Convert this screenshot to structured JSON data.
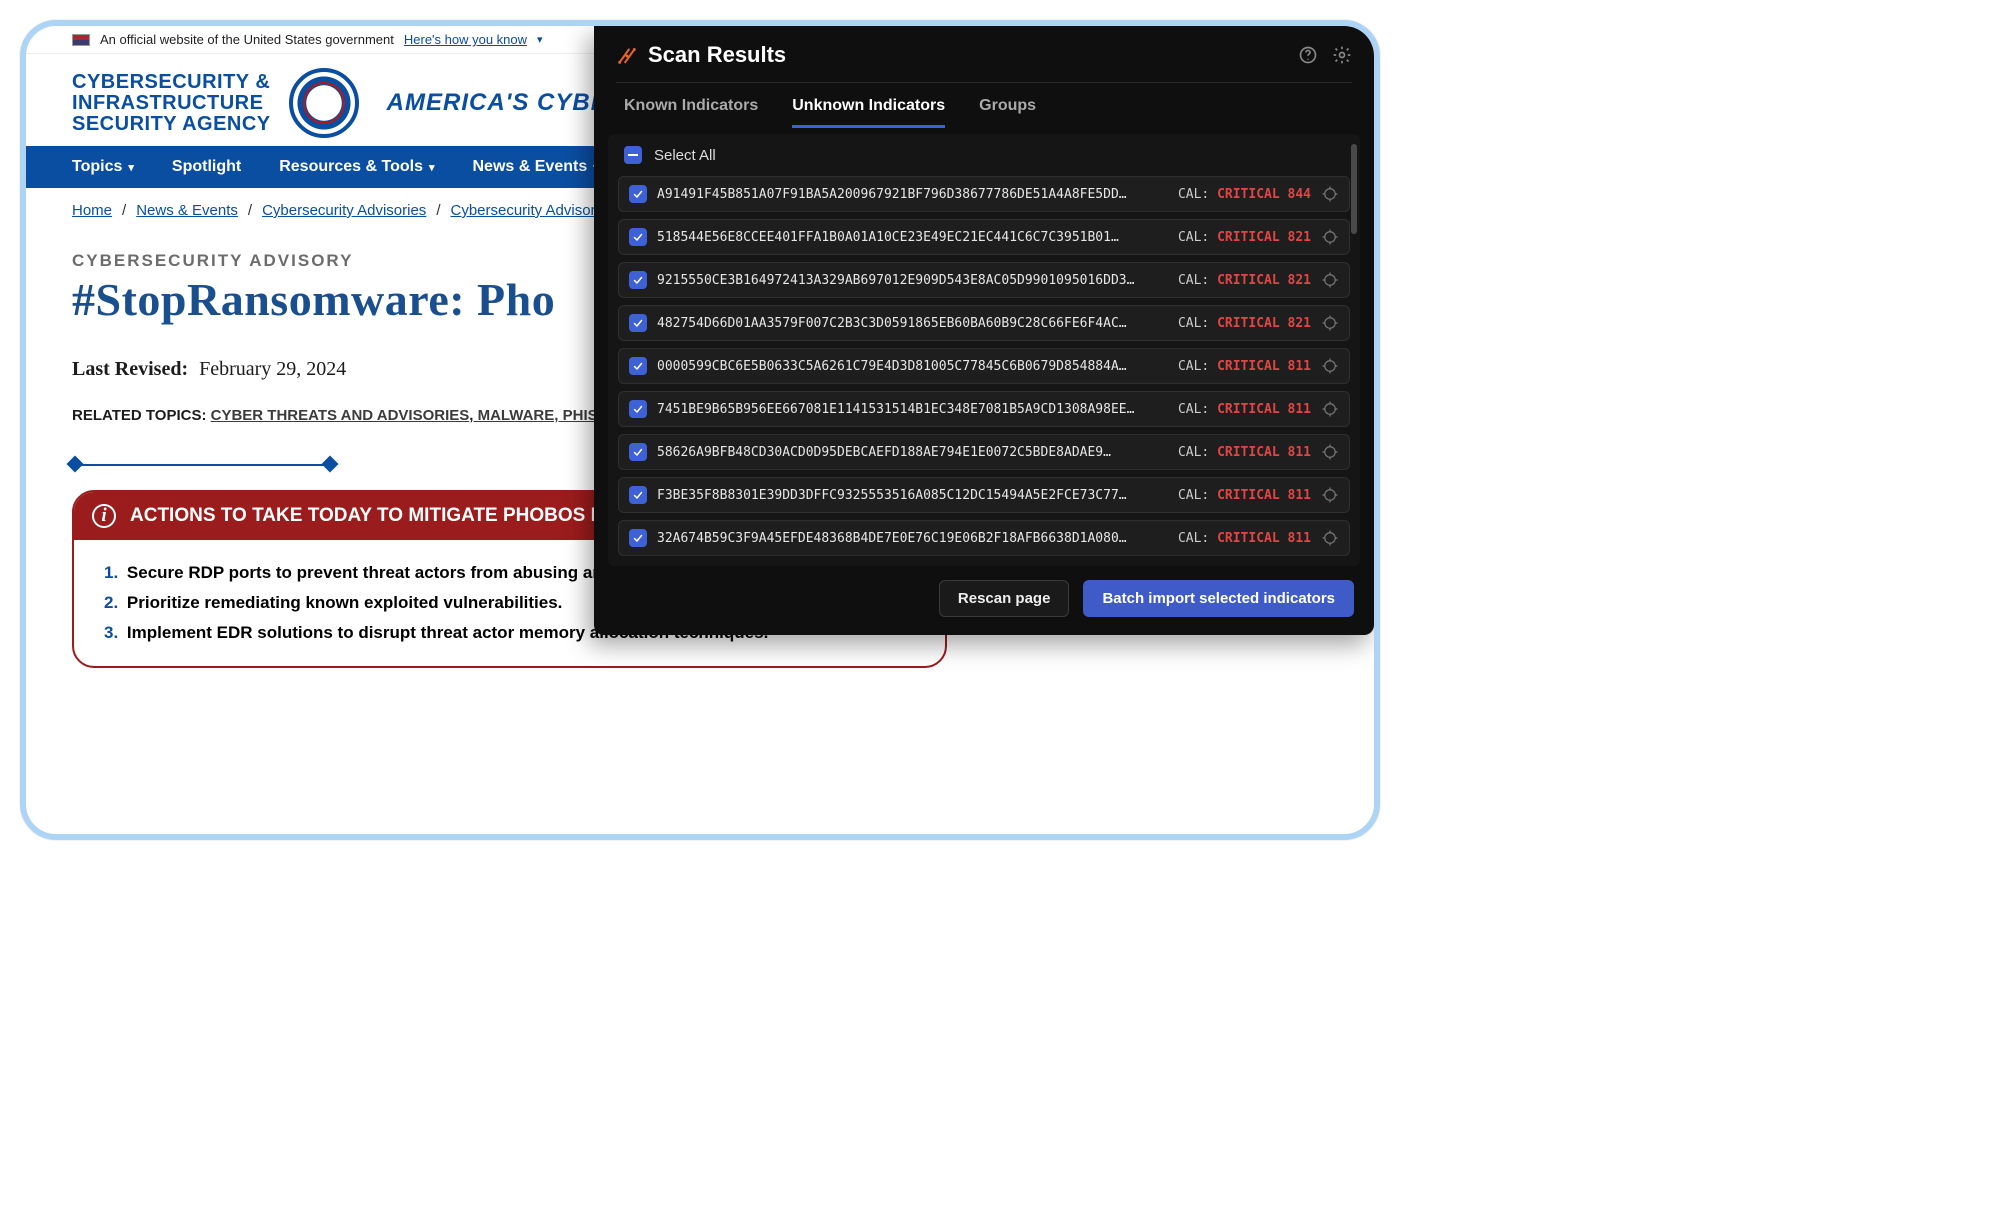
{
  "gov_banner": {
    "text": "An official website of the United States government",
    "link": "Here's how you know"
  },
  "agency": {
    "name_l1": "CYBERSECURITY &",
    "name_l2": "INFRASTRUCTURE",
    "name_l3": "SECURITY AGENCY",
    "tagline": "AMERICA'S CYBER D"
  },
  "topnav": [
    {
      "label": "Topics",
      "dropdown": true
    },
    {
      "label": "Spotlight",
      "dropdown": false
    },
    {
      "label": "Resources & Tools",
      "dropdown": true
    },
    {
      "label": "News & Events",
      "dropdown": true
    }
  ],
  "breadcrumbs": [
    "Home",
    "News & Events",
    "Cybersecurity Advisories",
    "Cybersecurity Advisory"
  ],
  "advisory": {
    "kicker": "CYBERSECURITY ADVISORY",
    "title": "#StopRansomware: Pho",
    "revised_label": "Last Revised:",
    "revised_value": "February 29, 2024"
  },
  "related": {
    "label": "RELATED TOPICS:",
    "topics": [
      "CYBER THREATS AND ADVISORIES",
      "MALWARE, PHISHING, A"
    ]
  },
  "callout": {
    "heading": "ACTIONS TO TAKE TODAY TO MITIGATE PHOBOS RANSOMWARE ACTIVITY:",
    "items": [
      "Secure RDP ports to prevent threat actors from abusing and leveraging RDP tools.",
      "Prioritize remediating known exploited vulnerabilities.",
      "Implement EDR solutions to disrupt threat actor memory allocation techniques."
    ]
  },
  "panel": {
    "title": "Scan Results",
    "tabs": [
      "Known Indicators",
      "Unknown Indicators",
      "Groups"
    ],
    "active_tab": 1,
    "select_all_label": "Select All",
    "cal_label": "CAL:",
    "crit_label": "CRITICAL",
    "rows": [
      {
        "hash": "A91491F45B851A07F91BA5A200967921BF796D38677786DE51A4A8FE5DD…",
        "score": 844
      },
      {
        "hash": "518544E56E8CCEE401FFA1B0A01A10CE23E49EC21EC441C6C7C3951B01…",
        "score": 821
      },
      {
        "hash": "9215550CE3B164972413A329AB697012E909D543E8AC05D9901095016DD3…",
        "score": 821
      },
      {
        "hash": "482754D66D01AA3579F007C2B3C3D0591865EB60BA60B9C28C66FE6F4AC…",
        "score": 821
      },
      {
        "hash": "0000599CBC6E5B0633C5A6261C79E4D3D81005C77845C6B0679D854884A…",
        "score": 811
      },
      {
        "hash": "7451BE9B65B956EE667081E1141531514B1EC348E7081B5A9CD1308A98EE…",
        "score": 811
      },
      {
        "hash": "58626A9BFB48CD30ACD0D95DEBCAEFD188AE794E1E0072C5BDE8ADAE9…",
        "score": 811
      },
      {
        "hash": "F3BE35F8B8301E39DD3DFFC9325553516A085C12DC15494A5E2FCE73C77…",
        "score": 811
      },
      {
        "hash": "32A674B59C3F9A45EFDE48368B4DE7E0E76C19E06B2F18AFB6638D1A080…",
        "score": 811
      }
    ],
    "buttons": {
      "rescan": "Rescan page",
      "import": "Batch import selected indicators"
    }
  }
}
